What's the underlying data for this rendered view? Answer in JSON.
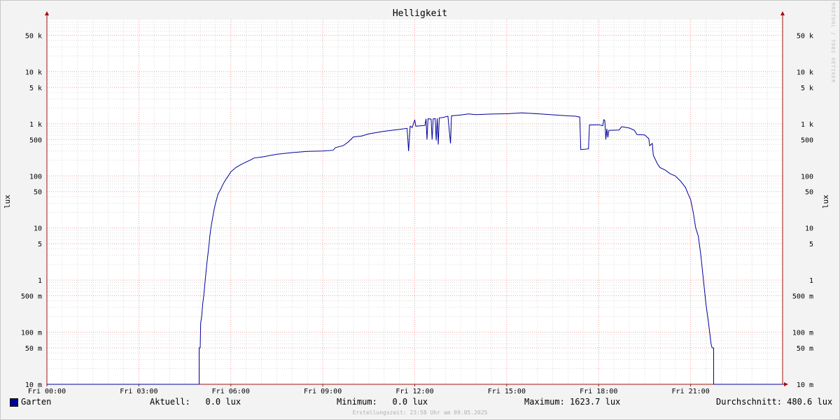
{
  "chart_data": {
    "type": "line",
    "title": "Helligkeit",
    "ylabel": "lux",
    "yscale": "log",
    "ylim": [
      0.01,
      100000
    ],
    "xlim": [
      "00:00",
      "24:00"
    ],
    "grid": true,
    "y_ticks": [
      {
        "value": 50000,
        "label": "50 k"
      },
      {
        "value": 10000,
        "label": "10 k"
      },
      {
        "value": 5000,
        "label": "5 k"
      },
      {
        "value": 1000,
        "label": "1 k"
      },
      {
        "value": 500,
        "label": "500"
      },
      {
        "value": 100,
        "label": "100"
      },
      {
        "value": 50,
        "label": "50"
      },
      {
        "value": 10,
        "label": "10"
      },
      {
        "value": 5,
        "label": "5"
      },
      {
        "value": 1,
        "label": "1"
      },
      {
        "value": 0.5,
        "label": "500 m"
      },
      {
        "value": 0.1,
        "label": "100 m"
      },
      {
        "value": 0.05,
        "label": "50 m"
      },
      {
        "value": 0.01,
        "label": "10 m"
      }
    ],
    "x_ticks": [
      {
        "hour": 0,
        "label": "Fri 00:00"
      },
      {
        "hour": 3,
        "label": "Fri 03:00"
      },
      {
        "hour": 6,
        "label": "Fri 06:00"
      },
      {
        "hour": 9,
        "label": "Fri 09:00"
      },
      {
        "hour": 12,
        "label": "Fri 12:00"
      },
      {
        "hour": 15,
        "label": "Fri 15:00"
      },
      {
        "hour": 18,
        "label": "Fri 18:00"
      },
      {
        "hour": 21,
        "label": "Fri 21:00"
      }
    ],
    "series": [
      {
        "name": "Garten",
        "color": "#00009c",
        "points": [
          [
            "00:00",
            0.01
          ],
          [
            "04:58",
            0.01
          ],
          [
            "04:58",
            0.05
          ],
          [
            "05:00",
            0.05
          ],
          [
            "05:01",
            0.15
          ],
          [
            "05:03",
            0.2
          ],
          [
            "05:05",
            0.35
          ],
          [
            "05:07",
            0.5
          ],
          [
            "05:09",
            0.8
          ],
          [
            "05:11",
            1.3
          ],
          [
            "05:13",
            2
          ],
          [
            "05:15",
            3
          ],
          [
            "05:17",
            4.5
          ],
          [
            "05:19",
            7
          ],
          [
            "05:21",
            10
          ],
          [
            "05:24",
            15
          ],
          [
            "05:27",
            22
          ],
          [
            "05:30",
            30
          ],
          [
            "05:35",
            45
          ],
          [
            "05:40",
            55
          ],
          [
            "05:45",
            70
          ],
          [
            "05:50",
            85
          ],
          [
            "05:55",
            100
          ],
          [
            "06:00",
            120
          ],
          [
            "06:10",
            145
          ],
          [
            "06:20",
            165
          ],
          [
            "06:30",
            185
          ],
          [
            "06:40",
            205
          ],
          [
            "06:45",
            220
          ],
          [
            "07:00",
            230
          ],
          [
            "07:30",
            260
          ],
          [
            "08:00",
            280
          ],
          [
            "08:30",
            295
          ],
          [
            "09:00",
            300
          ],
          [
            "09:20",
            310
          ],
          [
            "09:25",
            350
          ],
          [
            "09:40",
            380
          ],
          [
            "09:50",
            450
          ],
          [
            "10:00",
            560
          ],
          [
            "10:15",
            580
          ],
          [
            "10:30",
            640
          ],
          [
            "11:00",
            720
          ],
          [
            "11:30",
            780
          ],
          [
            "11:45",
            820
          ],
          [
            "11:48",
            300
          ],
          [
            "11:51",
            900
          ],
          [
            "11:55",
            850
          ],
          [
            "12:00",
            1200
          ],
          [
            "12:02",
            900
          ],
          [
            "12:20",
            930
          ],
          [
            "12:22",
            1250
          ],
          [
            "12:24",
            500
          ],
          [
            "12:26",
            1250
          ],
          [
            "12:32",
            1230
          ],
          [
            "12:34",
            500
          ],
          [
            "12:36",
            1240
          ],
          [
            "12:40",
            1260
          ],
          [
            "12:42",
            480
          ],
          [
            "12:44",
            1280
          ],
          [
            "12:46",
            400
          ],
          [
            "12:48",
            1300
          ],
          [
            "12:55",
            1320
          ],
          [
            "13:05",
            1400
          ],
          [
            "13:10",
            420
          ],
          [
            "13:12",
            1420
          ],
          [
            "13:30",
            1480
          ],
          [
            "13:45",
            1550
          ],
          [
            "14:00",
            1500
          ],
          [
            "14:30",
            1540
          ],
          [
            "15:00",
            1560
          ],
          [
            "15:30",
            1620
          ],
          [
            "16:00",
            1560
          ],
          [
            "16:30",
            1490
          ],
          [
            "17:00",
            1420
          ],
          [
            "17:15",
            1400
          ],
          [
            "17:23",
            1350
          ],
          [
            "17:25",
            320
          ],
          [
            "17:40",
            330
          ],
          [
            "17:42",
            950
          ],
          [
            "18:00",
            960
          ],
          [
            "18:08",
            920
          ],
          [
            "18:10",
            1200
          ],
          [
            "18:12",
            1150
          ],
          [
            "18:14",
            500
          ],
          [
            "18:16",
            800
          ],
          [
            "18:18",
            550
          ],
          [
            "18:20",
            750
          ],
          [
            "18:40",
            760
          ],
          [
            "18:45",
            880
          ],
          [
            "19:00",
            830
          ],
          [
            "19:10",
            750
          ],
          [
            "19:15",
            620
          ],
          [
            "19:30",
            610
          ],
          [
            "19:38",
            520
          ],
          [
            "19:40",
            380
          ],
          [
            "19:45",
            420
          ],
          [
            "19:47",
            250
          ],
          [
            "19:55",
            170
          ],
          [
            "20:00",
            145
          ],
          [
            "20:10",
            130
          ],
          [
            "20:20",
            110
          ],
          [
            "20:30",
            100
          ],
          [
            "20:40",
            80
          ],
          [
            "20:50",
            60
          ],
          [
            "20:55",
            45
          ],
          [
            "21:00",
            35
          ],
          [
            "21:05",
            20
          ],
          [
            "21:10",
            10
          ],
          [
            "21:15",
            7
          ],
          [
            "21:20",
            3
          ],
          [
            "21:25",
            1
          ],
          [
            "21:30",
            0.35
          ],
          [
            "21:35",
            0.15
          ],
          [
            "21:40",
            0.06
          ],
          [
            "21:42",
            0.05
          ],
          [
            "21:45",
            0.05
          ],
          [
            "21:45",
            0.01
          ],
          [
            "24:00",
            0.01
          ]
        ]
      }
    ]
  },
  "legend": {
    "series_name": "Garten",
    "swatch_color": "#00009c",
    "current": "Aktuell:   0.0 lux",
    "minimum": "Minimum:   0.0 lux",
    "maximum": "Maximum: 1623.7 lux",
    "average": "Durchschnitt: 480.6 lux"
  },
  "footer": "Erstellungszeit: 23:58 Uhr am 09.05.2025",
  "watermark": "RRDTOOL / TOBI OETIKER"
}
